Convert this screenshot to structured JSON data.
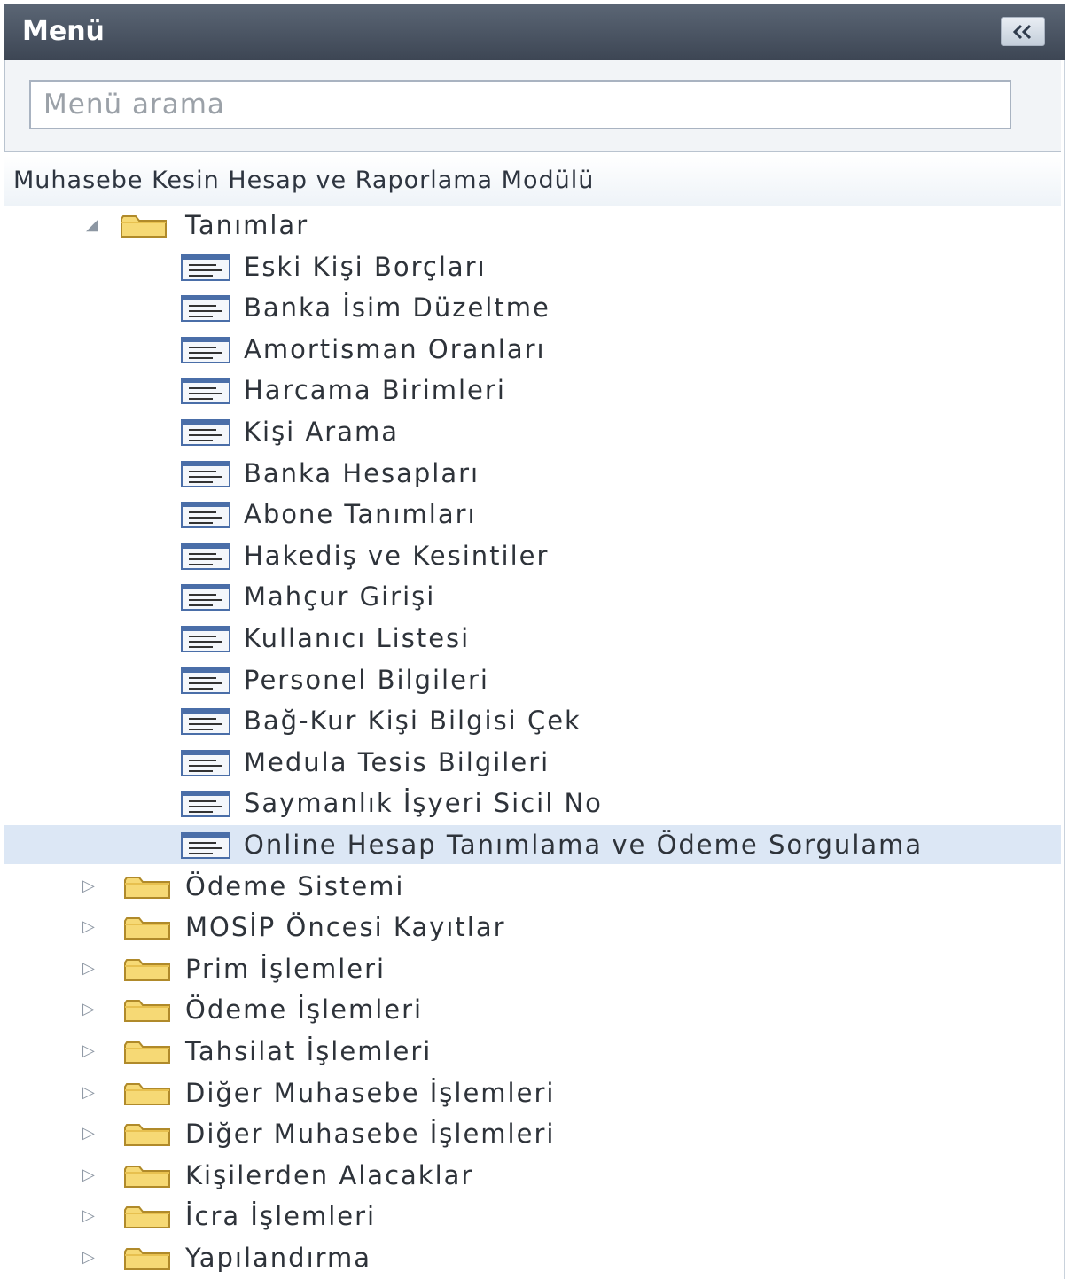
{
  "header": {
    "title": "Menü",
    "collapse_label": "«"
  },
  "search": {
    "placeholder": "Menü arama"
  },
  "module": "Muhasebe Kesin Hesap ve Raporlama Modülü",
  "tree": {
    "open_folder": {
      "label": "Tanımlar",
      "expander": "◢"
    },
    "items": [
      {
        "label": "Eski Kişi Borçları"
      },
      {
        "label": "Banka İsim Düzeltme"
      },
      {
        "label": "Amortisman Oranları"
      },
      {
        "label": "Harcama Birimleri"
      },
      {
        "label": "Kişi Arama"
      },
      {
        "label": "Banka Hesapları"
      },
      {
        "label": "Abone Tanımları"
      },
      {
        "label": "Hakediş ve Kesintiler"
      },
      {
        "label": "Mahçur Girişi"
      },
      {
        "label": "Kullanıcı Listesi"
      },
      {
        "label": "Personel Bilgileri"
      },
      {
        "label": "Bağ-Kur Kişi Bilgisi Çek"
      },
      {
        "label": "Medula Tesis Bilgileri"
      },
      {
        "label": "Saymanlık İşyeri Sicil No"
      },
      {
        "label": "Online Hesap Tanımlama ve Ödeme Sorgulama",
        "selected": true
      }
    ],
    "folders": [
      {
        "label": "Ödeme Sistemi",
        "expander": "▷"
      },
      {
        "label": "MOSİP Öncesi Kayıtlar",
        "expander": "▷"
      },
      {
        "label": "Prim İşlemleri",
        "expander": "▷"
      },
      {
        "label": "Ödeme İşlemleri",
        "expander": "▷"
      },
      {
        "label": "Tahsilat İşlemleri",
        "expander": "▷"
      },
      {
        "label": "Diğer Muhasebe İşlemleri",
        "expander": "▷"
      },
      {
        "label": "Diğer Muhasebe İşlemleri",
        "expander": "▷"
      },
      {
        "label": "Kişilerden Alacaklar",
        "expander": "▷"
      },
      {
        "label": "İcra İşlemleri",
        "expander": "▷"
      },
      {
        "label": "Yapılandırma",
        "expander": "▷"
      }
    ]
  },
  "colors": {
    "header": "#4a5461",
    "selected": "#dce7f5",
    "folder": "#f5d774",
    "item_icon": "#4a6ea8"
  },
  "icons": {
    "collapse": "double-chevron-left-icon",
    "folder": "folder-icon",
    "item": "menu-item-icon"
  }
}
